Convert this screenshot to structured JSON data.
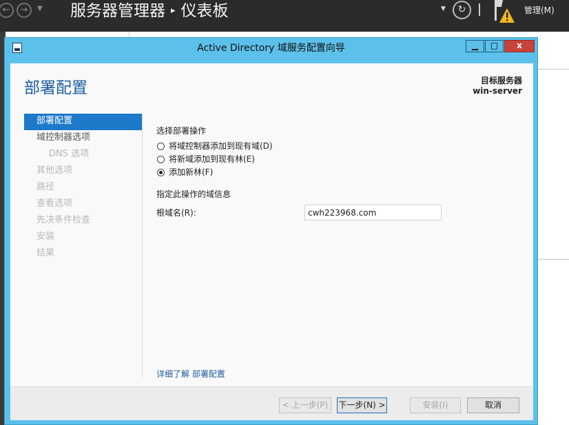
{
  "server_manager": {
    "title_app": "服务器管理器",
    "title_sep": "▸",
    "title_page": "仪表板",
    "manage_label": "管理(M)",
    "back_icon": "back-arrow-icon",
    "forward_icon": "forward-arrow-icon",
    "refresh_icon": "refresh-icon",
    "flag_icon": "notification-flag-warning-icon"
  },
  "wizard": {
    "window_title": "Active Directory 域服务配置向导",
    "controls": {
      "minimize": "▁",
      "maximize": "□",
      "close": "x"
    },
    "heading": "部署配置",
    "target_label": "目标服务器",
    "target_name": "win-server",
    "nav": [
      {
        "label": "部署配置",
        "state": "active"
      },
      {
        "label": "域控制器选项",
        "state": "enabled"
      },
      {
        "label": "DNS 选项",
        "state": "disabled"
      },
      {
        "label": "其他选项",
        "state": "disabled"
      },
      {
        "label": "路径",
        "state": "disabled"
      },
      {
        "label": "查看选项",
        "state": "disabled"
      },
      {
        "label": "先决条件检查",
        "state": "disabled"
      },
      {
        "label": "安装",
        "state": "disabled"
      },
      {
        "label": "结果",
        "state": "disabled"
      }
    ],
    "operation_label": "选择部署操作",
    "options": [
      {
        "label": "将域控制器添加到现有域(D)",
        "checked": false
      },
      {
        "label": "将新域添加到现有林(E)",
        "checked": false
      },
      {
        "label": "添加新林(F)",
        "checked": true
      }
    ],
    "domain_info_label": "指定此操作的域信息",
    "root_domain_label": "根域名(R):",
    "root_domain_value": "cwh223968.com",
    "learn_more": "详细了解 部署配置",
    "buttons": {
      "prev": "< 上一步(P)",
      "next": "下一步(N) >",
      "install": "安装(I)",
      "cancel": "取消"
    }
  },
  "colors": {
    "title_bar": "#5cc1ea",
    "accent": "#1d79c9",
    "heading": "#1b5d9e",
    "header_bg": "#2b2b2b"
  }
}
